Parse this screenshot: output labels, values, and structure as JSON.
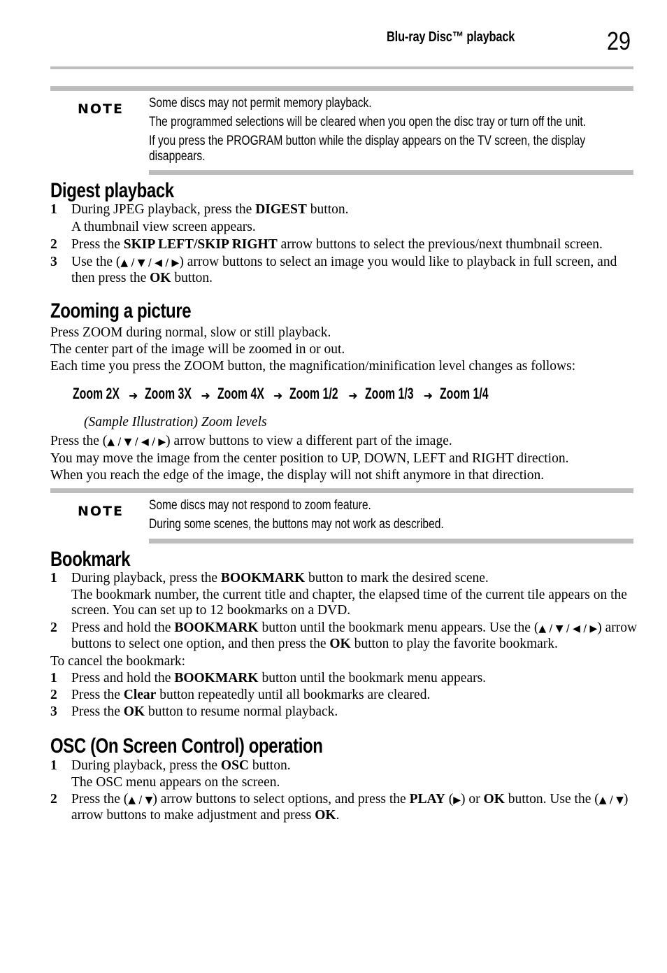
{
  "header": {
    "section_title": "Blu-ray Disc™ playback",
    "page_number": "29"
  },
  "note1": {
    "label": "NOTE",
    "lines": [
      "Some discs may not permit memory playback.",
      "The programmed selections will be cleared when you open the disc tray or turn off the unit.",
      "If you press the PROGRAM button while the display appears on the TV screen, the display disappears."
    ]
  },
  "digest": {
    "title": "Digest playback",
    "steps": [
      {
        "num": "1",
        "pre": "During JPEG playback, press the ",
        "bold": "DIGEST",
        "post": " button.",
        "sub": "A thumbnail view screen appears."
      },
      {
        "num": "2",
        "pre": "Press the ",
        "bold": "SKIP LEFT/SKIP RIGHT",
        "post": " arrow buttons to select the previous/next thumbnail screen."
      },
      {
        "num": "3",
        "pre": "Use the (",
        "arrows": "▲ / ▼ / ◀ / ▶",
        "mid": ") arrow buttons to select an image you would like to playback in full screen, and then press the ",
        "bold": "OK",
        "post": " button."
      }
    ]
  },
  "zooming": {
    "title": "Zooming a picture",
    "lines": [
      "Press ZOOM during normal, slow or still playback.",
      "The center part of the image will be zoomed in or out.",
      "Each time you press the ZOOM button, the magnification/minification level changes as follows:"
    ],
    "levels": [
      {
        "label": "Zoom 2X",
        "icon": "zoom-out-icon"
      },
      {
        "label": "Zoom 3X",
        "icon": "zoom-out-icon"
      },
      {
        "label": "Zoom 4X",
        "icon": "zoom-out-icon"
      },
      {
        "label": "Zoom 1/2",
        "icon": "zoom-in-icon"
      },
      {
        "label": "Zoom 1/3",
        "icon": "zoom-in-icon"
      },
      {
        "label": "Zoom 1/4",
        "icon": "zoom-in-icon"
      }
    ],
    "caption": "(Sample Illustration) Zoom levels",
    "after_pre": "Press the (",
    "after_arrows": "▲ / ▼ / ◀ / ▶",
    "after_post": ") arrow buttons to view a different part of the image.",
    "after_lines": [
      "You may move the image from the center position to UP, DOWN, LEFT and RIGHT direction.",
      "When you reach the edge of the image, the display will not shift anymore in that direction."
    ]
  },
  "note2": {
    "label": "NOTE",
    "lines": [
      "Some discs may not respond to zoom feature.",
      "During some scenes, the buttons may not work as described."
    ]
  },
  "bookmark": {
    "title": "Bookmark",
    "steps": [
      {
        "num": "1",
        "pre": "During playback, press the ",
        "bold": "BOOKMARK",
        "post": " button to mark the desired scene.",
        "sub": "The bookmark number, the current title and chapter, the elapsed time of the current tile appears on the screen. You can set up to 12 bookmarks on a DVD."
      },
      {
        "num": "2",
        "pre": "Press and hold the ",
        "bold": "BOOKMARK",
        "post": " button until the bookmark menu appears. Use the (",
        "arrows": "▲ / ▼ / ◀ / ▶",
        "mid": ") arrow buttons to select one option, and then press the ",
        "bold2": "OK",
        "post2": " button to play the favorite bookmark."
      }
    ],
    "cancel_intro": "To cancel the bookmark:",
    "cancel_steps": [
      {
        "num": "1",
        "pre": "Press and hold the ",
        "bold": "BOOKMARK",
        "post": " button until the bookmark menu appears."
      },
      {
        "num": "2",
        "pre": "Press the ",
        "bold": "Clear",
        "post": " button repeatedly until all bookmarks are cleared."
      },
      {
        "num": "3",
        "pre": "Press the ",
        "bold": "OK",
        "post": " button to resume normal playback."
      }
    ]
  },
  "osc": {
    "title": "OSC (On Screen Control) operation",
    "steps": [
      {
        "num": "1",
        "pre": "During playback, press the ",
        "bold": "OSC",
        "post": " button.",
        "sub": "The OSC menu appears on the screen."
      },
      {
        "num": "2",
        "pre": "Press the (",
        "arrows": "▲ / ▼",
        "mid": ") arrow buttons to select options, and press the ",
        "bold": "PLAY",
        "mid2": " (",
        "play": "▶",
        "mid3": ") or ",
        "bold2": "OK",
        "mid4": " button. Use the (",
        "arrows2": "▲ / ▼",
        "mid5": ") arrow buttons to make adjustment and press ",
        "bold3": "OK",
        "post": "."
      }
    ]
  }
}
